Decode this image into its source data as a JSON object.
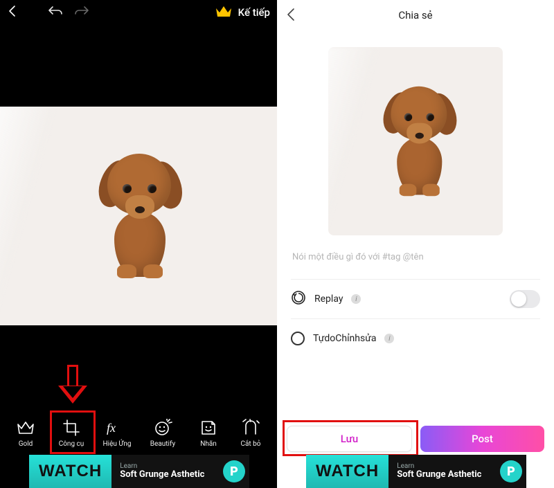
{
  "left": {
    "next_label": "Kế tiếp",
    "toolbar": [
      {
        "id": "gold",
        "label": "Gold"
      },
      {
        "id": "tools",
        "label": "Công cụ"
      },
      {
        "id": "effects",
        "label": "Hiệu Ứng"
      },
      {
        "id": "beautify",
        "label": "Beautify"
      },
      {
        "id": "sticker",
        "label": "Nhãn"
      },
      {
        "id": "cutout",
        "label": "Cắt bỏ"
      }
    ]
  },
  "right": {
    "title": "Chia sẻ",
    "caption_placeholder": "Nói một điều gì đó với #tag @tên",
    "replay_label": "Replay",
    "freeedit_label": "TựdoChỉnhsửa",
    "save_label": "Lưu",
    "post_label": "Post"
  },
  "ad": {
    "watch": "WATCH",
    "learn": "Learn",
    "title": "Soft Grunge Asthetic"
  }
}
